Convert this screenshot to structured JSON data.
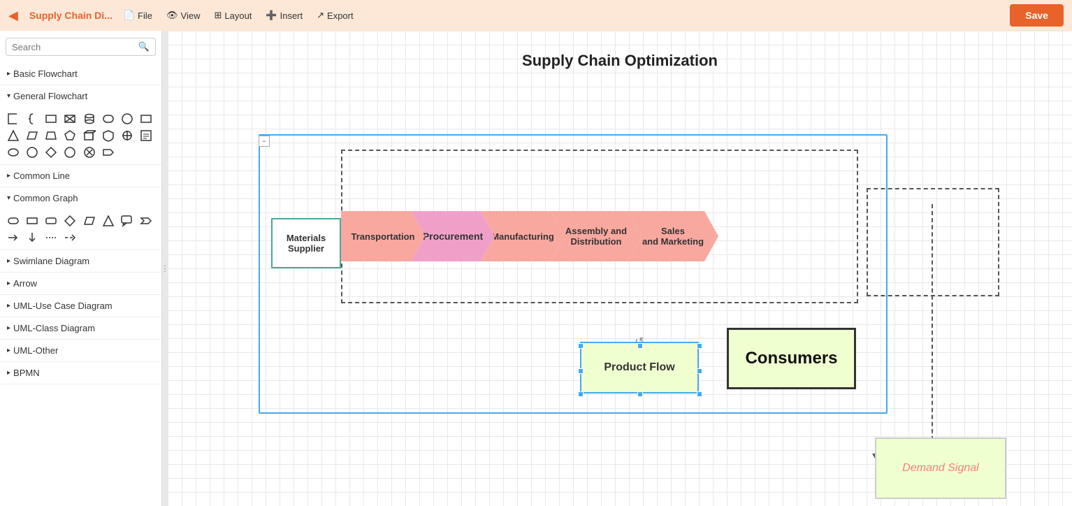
{
  "topbar": {
    "back_icon": "◀",
    "title": "Supply Chain Di...",
    "menu_items": [
      {
        "icon": "📄",
        "label": "File"
      },
      {
        "icon": "👁",
        "label": "View"
      },
      {
        "icon": "⊞",
        "label": "Layout"
      },
      {
        "icon": "➕",
        "label": "Insert"
      },
      {
        "icon": "↗",
        "label": "Export"
      }
    ],
    "save_label": "Save"
  },
  "sidebar": {
    "search_placeholder": "Search",
    "sections": [
      {
        "label": "Basic Flowchart",
        "collapsed": true
      },
      {
        "label": "General Flowchart",
        "collapsed": false
      },
      {
        "label": "Common Line",
        "collapsed": true
      },
      {
        "label": "Common Graph",
        "collapsed": false
      },
      {
        "label": "Swimlane Diagram",
        "collapsed": true
      },
      {
        "label": "Arrow",
        "collapsed": true
      },
      {
        "label": "UML-Use Case Diagram",
        "collapsed": true
      },
      {
        "label": "UML-Class Diagram",
        "collapsed": true
      },
      {
        "label": "UML-Other",
        "collapsed": true
      },
      {
        "label": "BPMN",
        "collapsed": true
      }
    ]
  },
  "diagram": {
    "title": "Supply Chain Optimization",
    "materials_supplier": "Materials\nSupplier",
    "chevrons": [
      {
        "label": "Transportation",
        "class": "chevron-transportation"
      },
      {
        "label": "Procurement",
        "class": "chevron-procurement"
      },
      {
        "label": "Manufacturing",
        "class": "chevron-manufacturing"
      },
      {
        "label": "Assembly and\nDistribution",
        "class": "chevron-assembly"
      },
      {
        "label": "Sales\nand Marketing",
        "class": "chevron-sales"
      }
    ],
    "product_flow_label": "Product Flow",
    "consumers_label": "Consumers",
    "demand_signal_label": "Demand Signal"
  }
}
